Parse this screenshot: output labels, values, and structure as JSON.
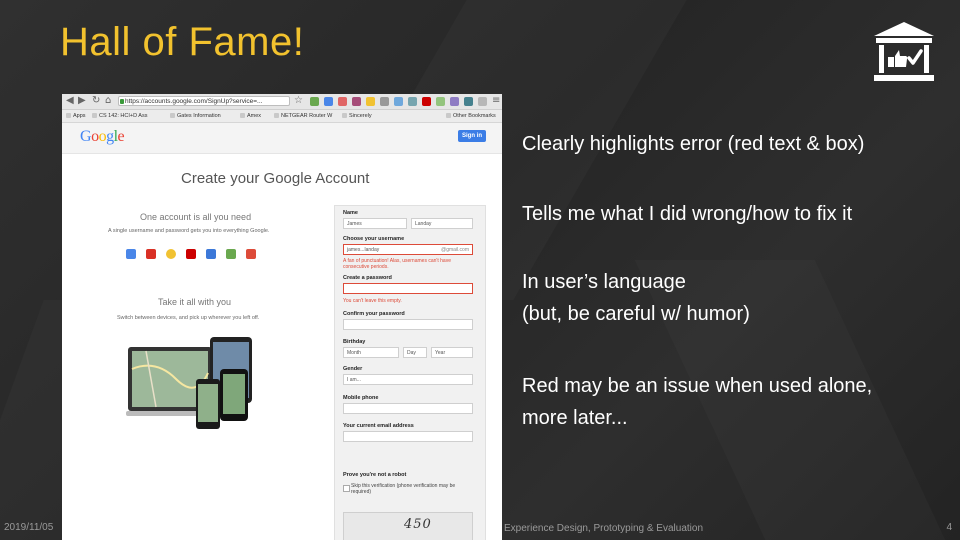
{
  "slide": {
    "title": "Hall of Fame!",
    "bullets": [
      "Clearly highlights error (red text & box)",
      "Tells me what I did wrong/how to fix it",
      "In user’s language",
      "(but, be careful w/ humor)",
      "Red may be an issue when used alone,",
      "more later..."
    ],
    "footer_date": "2019/11/05",
    "footer_course": "Experience Design, Prototyping & Evaluation",
    "page_number": "4",
    "icon": "hall-of-fame-building-thumbs-up-check-icon",
    "title_color": "#f2c22e"
  },
  "browser": {
    "url": "https://accounts.google.com/SignUp?service=...",
    "bookmarks": [
      "Apps",
      "CS 142: HCI+D Ass",
      "Gates Information",
      "Amex",
      "NETGEAR Router W",
      "Sincerely",
      "Other Bookmarks"
    ]
  },
  "google_page": {
    "logo": "Google",
    "signin_label": "Sign in",
    "title": "Create your Google Account",
    "one_account": "One account is all you need",
    "one_account_sub": "A single username and password gets you into everything Google.",
    "take_all": "Take it all with you",
    "take_all_sub": "Switch between devices, and pick up wherever you left off.",
    "form": {
      "name_label": "Name",
      "first_name": "James",
      "last_name": "Landay",
      "username_label": "Choose your username",
      "username_value": "james...landay",
      "username_suffix": "@gmail.com",
      "username_error": "A fan of punctuation! Alas, usernames can't have consecutive periods.",
      "password_label": "Create a password",
      "password_error": "You can't leave this empty.",
      "confirm_label": "Confirm your password",
      "birthday_label": "Birthday",
      "birth_month": "Month",
      "birth_day": "Day",
      "birth_year": "Year",
      "gender_label": "Gender",
      "gender_value": "I am...",
      "mobile_label": "Mobile phone",
      "email_label": "Your current email address",
      "robot_label": "Prove you're not a robot",
      "robot_text": "Skip this verification (phone verification may be required)",
      "captcha_text": "450"
    }
  }
}
